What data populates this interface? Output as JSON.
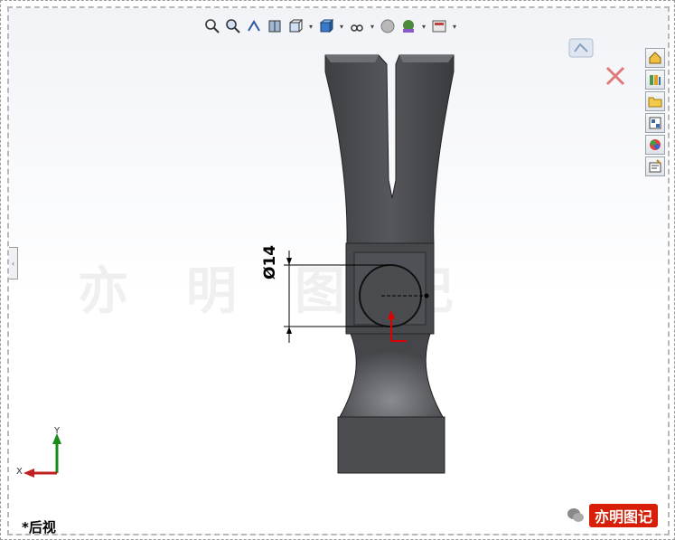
{
  "view": {
    "label": "*后视"
  },
  "dimension": {
    "text": "Ø14"
  },
  "triad": {
    "x_label": "X",
    "y_label": "Y"
  },
  "watermark": {
    "chars": [
      "亦",
      "明",
      "图",
      "记"
    ]
  },
  "badge": {
    "text": "亦明图记"
  },
  "toolbar": {
    "icons": [
      "zoom-to-fit-icon",
      "zoom-area-icon",
      "previous-view-icon",
      "section-view-icon",
      "view-orientation-icon",
      "display-style-icon",
      "hide-show-icon",
      "appearance-icon",
      "scene-icon",
      "view-settings-icon"
    ]
  },
  "taskpane": {
    "icons": [
      "resources-icon",
      "design-library-icon",
      "file-explorer-icon",
      "view-palette-icon",
      "appearances-icon",
      "custom-properties-icon"
    ]
  },
  "colors": {
    "part": "#4f5055",
    "part_light": "#6f7075",
    "badge": "#d81e06"
  }
}
